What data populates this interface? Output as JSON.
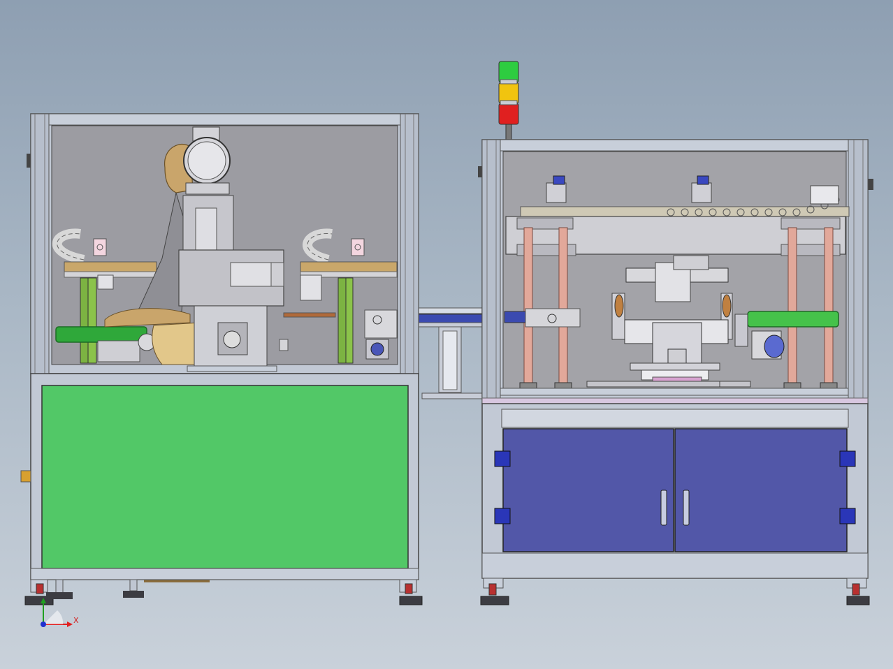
{
  "view": {
    "background_top": "#8e9fb2",
    "background_bottom": "#c9d1da"
  },
  "triad": {
    "x_label": "X",
    "y_label": "",
    "x_color": "#e02020",
    "y_color": "#20a020",
    "z_color": "#2030d0"
  },
  "left_machine": {
    "frame_color": "#b9c1d0",
    "interior_color": "#9a9aa0",
    "lower_panel_color": "#52c867",
    "roller_color": "#2fa83a",
    "bracket_color": "#7cb342"
  },
  "right_machine": {
    "frame_color": "#b9c1d0",
    "interior_color": "#a3a3a8",
    "cabinet_door_color": "#5257a8",
    "column_color": "#e2a89a",
    "roller_color": "#45c24a",
    "motor_color": "#5a6ad0"
  },
  "signal_tower": {
    "colors": [
      "#2ecc40",
      "#f1c40f",
      "#e02020"
    ]
  },
  "conveyor": {
    "color": "#b0b8c6"
  }
}
